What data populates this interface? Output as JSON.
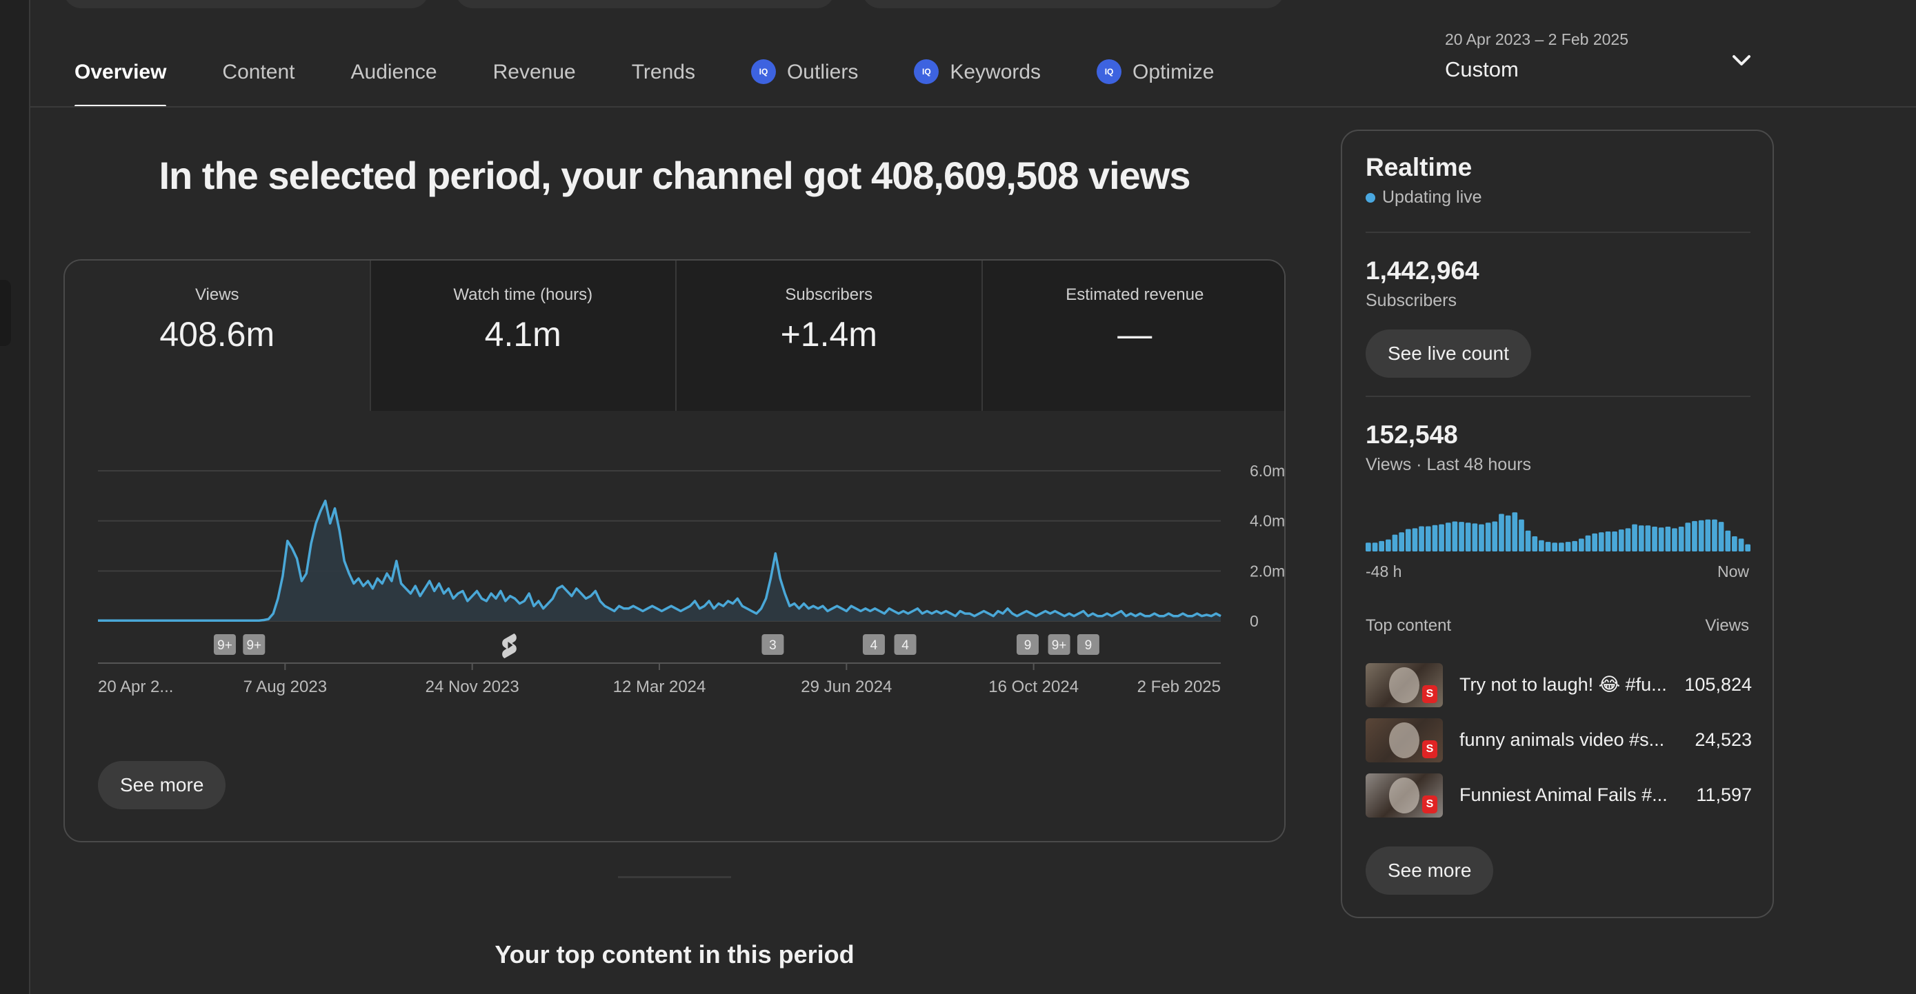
{
  "tabs": [
    {
      "label": "Overview",
      "active": true,
      "iq": false
    },
    {
      "label": "Content",
      "active": false,
      "iq": false
    },
    {
      "label": "Audience",
      "active": false,
      "iq": false
    },
    {
      "label": "Revenue",
      "active": false,
      "iq": false
    },
    {
      "label": "Trends",
      "active": false,
      "iq": false
    },
    {
      "label": "Outliers",
      "active": false,
      "iq": true
    },
    {
      "label": "Keywords",
      "active": false,
      "iq": true
    },
    {
      "label": "Optimize",
      "active": false,
      "iq": true
    }
  ],
  "iq_badge": "IQ",
  "date_range": {
    "range": "20 Apr 2023 – 2 Feb 2025",
    "preset": "Custom"
  },
  "headline": "In the selected period, your channel got 408,609,508 views",
  "metrics": [
    {
      "label": "Views",
      "value": "408.6m"
    },
    {
      "label": "Watch time (hours)",
      "value": "4.1m"
    },
    {
      "label": "Subscribers",
      "value": "+1.4m"
    },
    {
      "label": "Estimated revenue",
      "value": "—"
    }
  ],
  "chart_data": {
    "type": "area",
    "series": [
      {
        "values": [
          0.02,
          0.02,
          0.02,
          0.02,
          0.02,
          0.02,
          0.02,
          0.02,
          0.02,
          0.02,
          0.02,
          0.02,
          0.02,
          0.02,
          0.02,
          0.02,
          0.02,
          0.02,
          0.02,
          0.02,
          0.02,
          0.02,
          0.02,
          0.02,
          0.02,
          0.02,
          0.02,
          0.02,
          0.02,
          0.02,
          0.02,
          0.02,
          0.02,
          0.02,
          0.02,
          0.04,
          0.08,
          0.3,
          0.9,
          1.8,
          3.2,
          2.9,
          2.5,
          1.6,
          1.9,
          3.1,
          3.9,
          4.4,
          4.8,
          3.9,
          4.5,
          3.6,
          2.4,
          1.9,
          1.5,
          1.7,
          1.4,
          1.6,
          1.3,
          1.7,
          1.5,
          1.9,
          1.6,
          2.4,
          1.5,
          1.3,
          1.1,
          1.4,
          1.0,
          1.3,
          1.6,
          1.2,
          1.5,
          1.1,
          1.3,
          0.9,
          1.1,
          1.2,
          0.8,
          1.0,
          1.2,
          0.9,
          0.8,
          1.1,
          0.9,
          1.2,
          0.8,
          1.0,
          0.9,
          0.7,
          0.8,
          1.1,
          0.6,
          0.8,
          0.5,
          0.7,
          0.9,
          1.3,
          1.4,
          1.2,
          1.0,
          1.3,
          1.1,
          0.9,
          1.0,
          1.2,
          0.8,
          0.6,
          0.5,
          0.4,
          0.6,
          0.5,
          0.5,
          0.6,
          0.5,
          0.4,
          0.5,
          0.6,
          0.5,
          0.4,
          0.5,
          0.6,
          0.5,
          0.4,
          0.5,
          0.6,
          0.8,
          0.5,
          0.6,
          0.8,
          0.5,
          0.7,
          0.6,
          0.8,
          0.7,
          0.9,
          0.6,
          0.5,
          0.4,
          0.3,
          0.5,
          0.9,
          1.7,
          2.7,
          1.7,
          1.1,
          0.6,
          0.7,
          0.5,
          0.7,
          0.5,
          0.6,
          0.5,
          0.6,
          0.4,
          0.5,
          0.6,
          0.5,
          0.4,
          0.6,
          0.5,
          0.4,
          0.5,
          0.4,
          0.5,
          0.4,
          0.3,
          0.5,
          0.4,
          0.3,
          0.4,
          0.3,
          0.4,
          0.5,
          0.3,
          0.4,
          0.3,
          0.4,
          0.3,
          0.4,
          0.3,
          0.2,
          0.4,
          0.3,
          0.3,
          0.2,
          0.3,
          0.4,
          0.3,
          0.2,
          0.4,
          0.3,
          0.5,
          0.3,
          0.2,
          0.3,
          0.4,
          0.3,
          0.2,
          0.3,
          0.4,
          0.3,
          0.4,
          0.3,
          0.2,
          0.3,
          0.2,
          0.3,
          0.4,
          0.2,
          0.3,
          0.2,
          0.2,
          0.3,
          0.2,
          0.3,
          0.4,
          0.2,
          0.3,
          0.2,
          0.3,
          0.2,
          0.2,
          0.3,
          0.2,
          0.2,
          0.3,
          0.2,
          0.2,
          0.3,
          0.2,
          0.2,
          0.3,
          0.2,
          0.25,
          0.2,
          0.3,
          0.2
        ]
      }
    ],
    "ymax": 6.0,
    "y_ticks": [
      {
        "label": "6.0m",
        "value": 6
      },
      {
        "label": "4.0m",
        "value": 4
      },
      {
        "label": "2.0m",
        "value": 2
      },
      {
        "label": "0",
        "value": 0
      }
    ],
    "x_labels": [
      "20 Apr 2...",
      "7 Aug 2023",
      "24 Nov 2023",
      "12 Mar 2024",
      "29 Jun 2024",
      "16 Oct 2024",
      "2 Feb 2025"
    ],
    "markers": [
      {
        "label": "9+",
        "at": 0.113
      },
      {
        "label": "9+",
        "at": 0.139
      },
      {
        "label": "",
        "at": 0.367,
        "shorts_icon": true
      },
      {
        "label": "3",
        "at": 0.601
      },
      {
        "label": "4",
        "at": 0.691
      },
      {
        "label": "4",
        "at": 0.719
      },
      {
        "label": "9",
        "at": 0.828
      },
      {
        "label": "9+",
        "at": 0.856
      },
      {
        "label": "9",
        "at": 0.882
      }
    ],
    "line_color": "#4aa8d8",
    "fill_color": "#2d3a42"
  },
  "chart_see_more": "See more",
  "top_content_title": "Your top content in this period",
  "realtime": {
    "title": "Realtime",
    "live_label": "Updating live",
    "subscribers_value": "1,442,964",
    "subscribers_label": "Subscribers",
    "see_live_count": "See live count",
    "views_value": "152,548",
    "views_label": "Views · Last 48 hours",
    "bars": [
      0.22,
      0.22,
      0.26,
      0.3,
      0.42,
      0.48,
      0.56,
      0.58,
      0.63,
      0.63,
      0.66,
      0.68,
      0.72,
      0.75,
      0.74,
      0.72,
      0.7,
      0.68,
      0.72,
      0.75,
      0.94,
      0.9,
      0.98,
      0.8,
      0.52,
      0.38,
      0.28,
      0.24,
      0.22,
      0.22,
      0.24,
      0.26,
      0.32,
      0.4,
      0.45,
      0.48,
      0.5,
      0.5,
      0.55,
      0.58,
      0.68,
      0.65,
      0.65,
      0.62,
      0.6,
      0.62,
      0.58,
      0.62,
      0.72,
      0.76,
      0.78,
      0.8,
      0.8,
      0.74,
      0.52,
      0.38,
      0.32,
      0.18
    ],
    "bar_color": "#4aa8d8",
    "axis_start": "-48 h",
    "axis_end": "Now",
    "top_content_label": "Top content",
    "views_column": "Views",
    "rows": [
      {
        "title": "Try not to laugh! 😂 #fu...",
        "views": "105,824",
        "thumb": "#7a6e60"
      },
      {
        "title": "funny animals video #s...",
        "views": "24,523",
        "thumb": "#5a4638"
      },
      {
        "title": "Funniest Animal Fails #...",
        "views": "11,597",
        "thumb": "#8d8782"
      }
    ],
    "see_more": "See more"
  }
}
